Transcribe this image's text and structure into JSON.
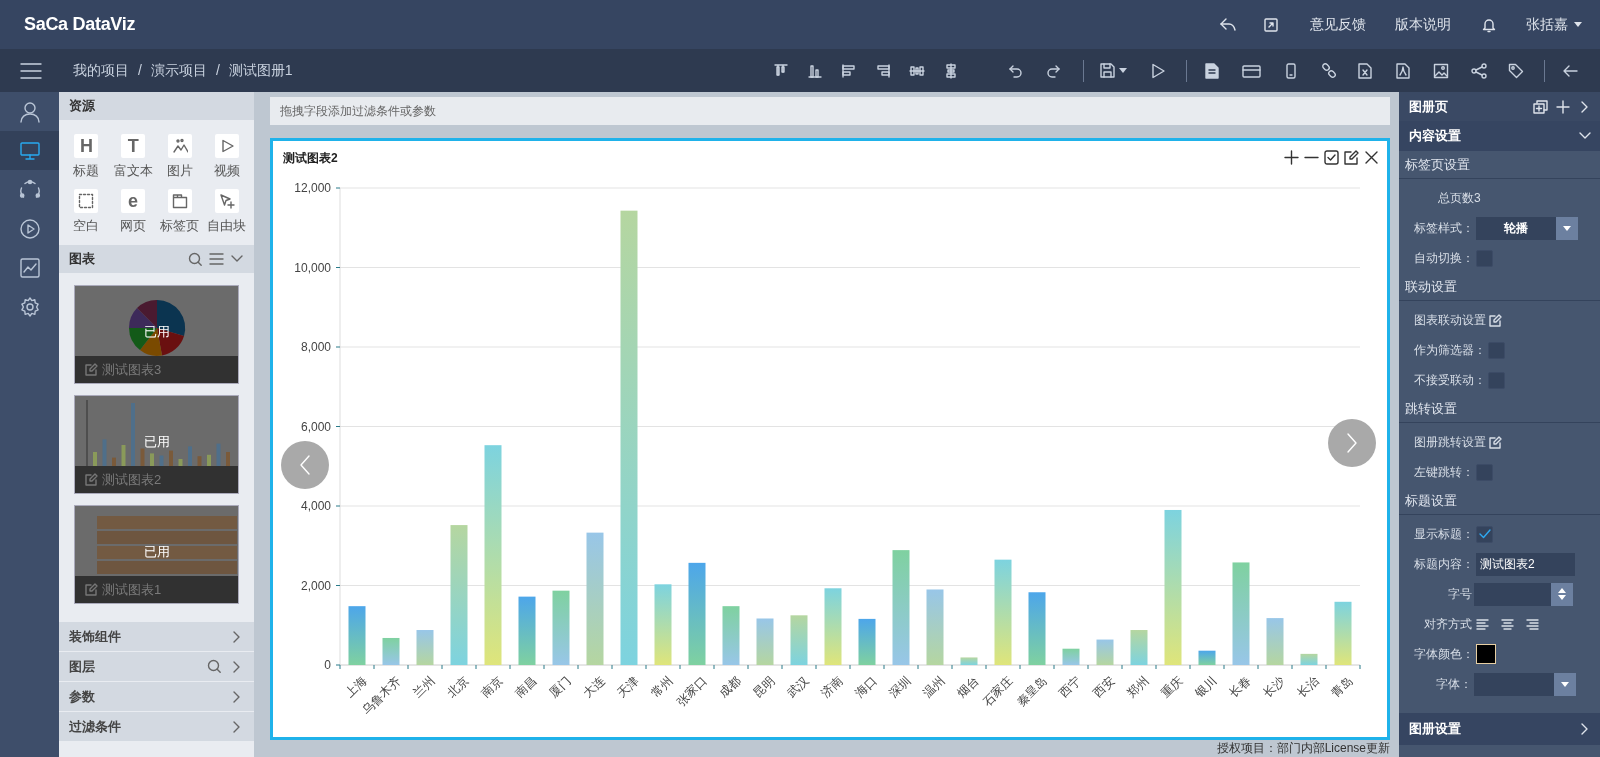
{
  "header": {
    "logo": "SaCa DataViz",
    "links": [
      "意见反馈",
      "版本说明"
    ],
    "user": "张括嘉"
  },
  "breadcrumb": {
    "separator": "/",
    "items": [
      "我的项目",
      "演示项目",
      "测试图册1"
    ]
  },
  "rail": [
    {
      "kind": "user",
      "selected": false
    },
    {
      "kind": "screen",
      "selected": true
    },
    {
      "kind": "cycle",
      "selected": false
    },
    {
      "kind": "play",
      "selected": false
    },
    {
      "kind": "trend",
      "selected": false
    },
    {
      "kind": "settings",
      "selected": false
    }
  ],
  "resources": {
    "title": "资源",
    "items": [
      {
        "label": "标题",
        "kind": "glyph",
        "glyph": "H"
      },
      {
        "label": "富文本",
        "kind": "glyph",
        "glyph": "T"
      },
      {
        "label": "图片",
        "kind": "image"
      },
      {
        "label": "视频",
        "kind": "video"
      },
      {
        "label": "空白",
        "kind": "blank"
      },
      {
        "label": "网页",
        "kind": "glyph",
        "glyph": "e"
      },
      {
        "label": "标签页",
        "kind": "tab"
      },
      {
        "label": "自由块",
        "kind": "pointer"
      }
    ]
  },
  "charts_panel": {
    "title": "图表",
    "expanded": true,
    "thumbnails": [
      {
        "kind": "pie",
        "badge": "已用",
        "caption": "测试图表3"
      },
      {
        "kind": "bar",
        "badge": "已用",
        "caption": "测试图表2"
      },
      {
        "kind": "table",
        "badge": "已用",
        "caption": "测试图表1"
      }
    ]
  },
  "sections": [
    {
      "label": "装饰组件",
      "searchable": false,
      "expanded": false
    },
    {
      "label": "图层",
      "searchable": true,
      "expanded": false
    },
    {
      "label": "参数",
      "searchable": false,
      "expanded": false
    },
    {
      "label": "过滤条件",
      "searchable": false,
      "expanded": false
    }
  ],
  "filter_bar": {
    "placeholder": "拖拽字段添加过滤条件或参数"
  },
  "chart_card": {
    "title": "测试图表2",
    "chart_data": {
      "type": "bar",
      "categories": [
        "上海",
        "乌鲁木齐",
        "兰州",
        "北京",
        "南京",
        "南昌",
        "厦门",
        "大连",
        "天津",
        "常州",
        "张家口",
        "成都",
        "昆明",
        "武汉",
        "济南",
        "海口",
        "深圳",
        "温州",
        "烟台",
        "石家庄",
        "秦皇岛",
        "西宁",
        "西安",
        "郑州",
        "重庆",
        "银川",
        "长春",
        "长沙",
        "长治",
        "青岛"
      ],
      "values": [
        1480,
        680,
        880,
        3520,
        5530,
        1720,
        1870,
        3330,
        11430,
        2030,
        2570,
        1480,
        1170,
        1250,
        1930,
        1160,
        2890,
        1900,
        190,
        2650,
        1830,
        410,
        640,
        880,
        3900,
        360,
        2580,
        1180,
        280,
        1590
      ],
      "ylim": [
        0,
        12000
      ],
      "grid": true,
      "yticks": [
        {
          "value": 0,
          "label": "0"
        },
        {
          "value": 2000,
          "label": "2,000"
        },
        {
          "value": 4000,
          "label": "4,000"
        },
        {
          "value": 6000,
          "label": "6,000"
        },
        {
          "value": 8000,
          "label": "8,000"
        },
        {
          "value": 10000,
          "label": "10,000"
        },
        {
          "value": 12000,
          "label": "12,000"
        }
      ]
    }
  },
  "license_note": "授权项目：部门内部License更新",
  "properties": {
    "title": "图册页",
    "content": {
      "title": "内容设置",
      "expanded": true,
      "groups": [
        {
          "title": "标签页设置",
          "rows": [
            {
              "kind": "text",
              "label": "总页数3"
            },
            {
              "kind": "select",
              "label": "标签样式：",
              "value": "轮播"
            },
            {
              "kind": "checkbox",
              "label": "自动切换：",
              "checked": false
            }
          ]
        },
        {
          "title": "联动设置",
          "rows": [
            {
              "kind": "link",
              "label": "图表联动设置"
            },
            {
              "kind": "checkbox",
              "label": "作为筛选器：",
              "checked": false
            },
            {
              "kind": "checkbox",
              "label": "不接受联动：",
              "checked": false
            }
          ]
        },
        {
          "title": "跳转设置",
          "rows": [
            {
              "kind": "link",
              "label": "图册跳转设置"
            },
            {
              "kind": "checkbox",
              "label": "左键跳转：",
              "checked": false
            }
          ]
        },
        {
          "title": "标题设置",
          "rows": [
            {
              "kind": "checkbox",
              "label": "显示标题：",
              "checked": true
            },
            {
              "kind": "input",
              "label": "标题内容：",
              "value": "测试图表2"
            },
            {
              "kind": "spinner",
              "label": "字号"
            },
            {
              "kind": "align",
              "label": "对齐方式"
            },
            {
              "kind": "color",
              "label": "字体颜色：",
              "color": "#000000"
            },
            {
              "kind": "select",
              "label": "字体："
            }
          ]
        }
      ]
    },
    "footer": {
      "title": "图册设置",
      "expanded": false
    }
  }
}
